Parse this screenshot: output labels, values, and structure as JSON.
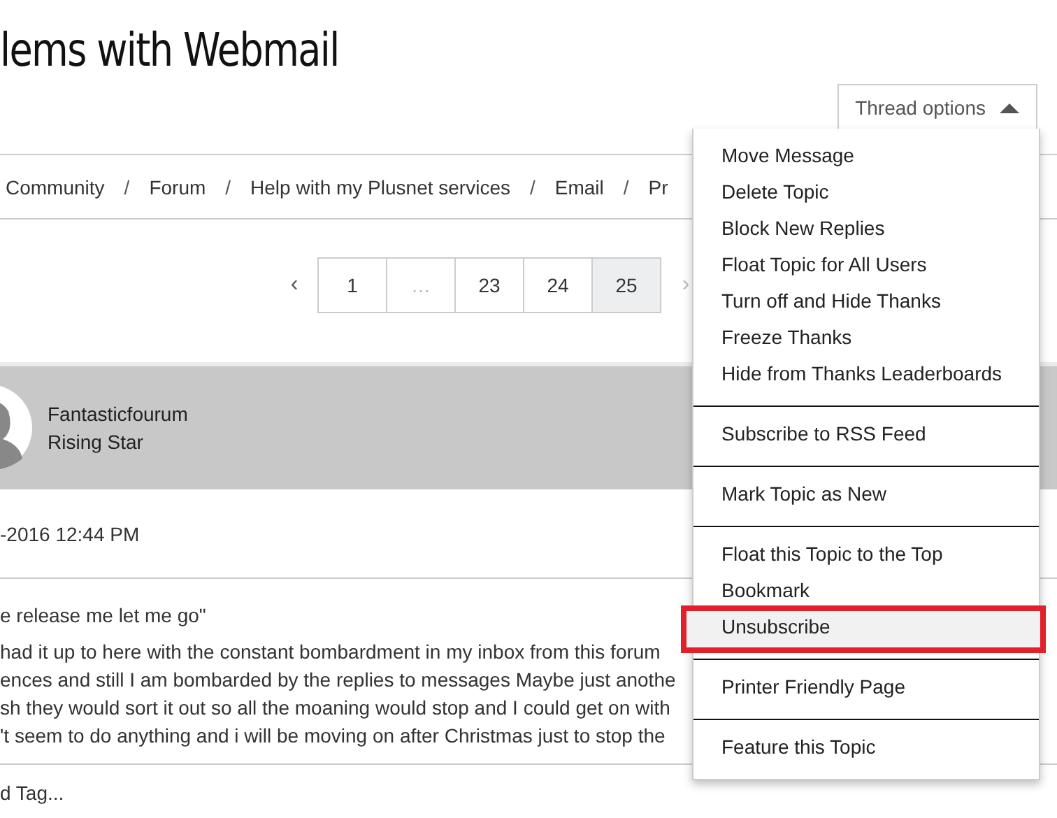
{
  "title": "lems with Webmail",
  "thread_options": {
    "label": "Thread options",
    "expanded": true
  },
  "breadcrumbs": [
    "Community",
    "Forum",
    "Help with my Plusnet services",
    "Email",
    "Pr"
  ],
  "breadcrumb_separators": [
    "/",
    "/",
    "/",
    "/"
  ],
  "pagination": {
    "prev": "‹",
    "next": "›",
    "pages": [
      {
        "label": "1",
        "selected": false
      },
      {
        "label": "…",
        "selected": false
      },
      {
        "label": "23",
        "selected": false
      },
      {
        "label": "24",
        "selected": false
      },
      {
        "label": "25",
        "selected": true
      }
    ]
  },
  "post": {
    "author": "Fantasticfourum",
    "rank": "Rising Star",
    "date": "-2016 12:44 PM",
    "subject": "e release me let me go\"",
    "body_lines": [
      "had it up to here with the constant bombardment in my inbox from this forum",
      "ences and still I am bombarded by the replies to messages Maybe just anothe",
      "sh they would sort it out so all the moaning would stop and I could get on with",
      "'t seem to do anything and i will be moving on after Christmas just to stop the"
    ],
    "tag": "d Tag..."
  },
  "menu": {
    "groups": [
      [
        {
          "label": "Move Message",
          "highlighted": false
        },
        {
          "label": "Delete Topic",
          "highlighted": false
        },
        {
          "label": "Block New Replies",
          "highlighted": false
        },
        {
          "label": "Float Topic for All Users",
          "highlighted": false
        },
        {
          "label": "Turn off and Hide Thanks",
          "highlighted": false
        },
        {
          "label": "Freeze Thanks",
          "highlighted": false
        },
        {
          "label": "Hide from Thanks Leaderboards",
          "highlighted": false
        }
      ],
      [
        {
          "label": "Subscribe to RSS Feed",
          "highlighted": false
        }
      ],
      [
        {
          "label": "Mark Topic as New",
          "highlighted": false
        }
      ],
      [
        {
          "label": "Float this Topic to the Top",
          "highlighted": false
        },
        {
          "label": "Bookmark",
          "highlighted": false
        },
        {
          "label": "Unsubscribe",
          "highlighted": true
        }
      ],
      [
        {
          "label": "Printer Friendly Page",
          "highlighted": false
        }
      ],
      [
        {
          "label": "Feature this Topic",
          "highlighted": false
        }
      ]
    ]
  }
}
